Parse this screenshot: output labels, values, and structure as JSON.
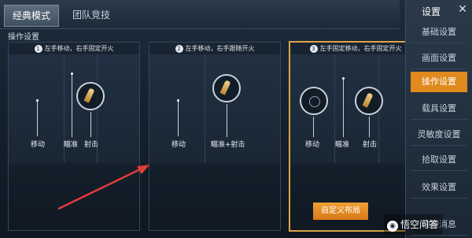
{
  "tabs": [
    {
      "label": "经典模式"
    },
    {
      "label": "团队竞技"
    }
  ],
  "section_label": "操作设置",
  "panels": [
    {
      "num": "1",
      "title": "左手移动，右手固定开火",
      "labels": {
        "move": "移动",
        "aim": "瞄准",
        "fire": "射击"
      }
    },
    {
      "num": "2",
      "title": "左手移动，右手跟随开火",
      "labels": {
        "move": "移动",
        "aim_fire": "瞄准+射击"
      }
    },
    {
      "num": "3",
      "title": "左手固定移动，右手固定开火",
      "labels": {
        "move": "移动",
        "aim": "瞄准",
        "fire": "射击"
      }
    }
  ],
  "sidebar": {
    "title": "设置",
    "items": [
      {
        "label": "基础设置"
      },
      {
        "label": "画面设置"
      },
      {
        "label": "操作设置"
      },
      {
        "label": "载具设置"
      },
      {
        "label": "灵敏度设置"
      },
      {
        "label": "拾取设置"
      },
      {
        "label": "效果设置"
      },
      {
        "label": "快捷消息"
      }
    ],
    "active_index": 2
  },
  "custom_button": "自定义布局",
  "watermark": {
    "text": "悟空问答"
  },
  "colors": {
    "accent": "#e08a1f",
    "selected_border": "#d9a64a",
    "arrow": "#e23b3b"
  }
}
